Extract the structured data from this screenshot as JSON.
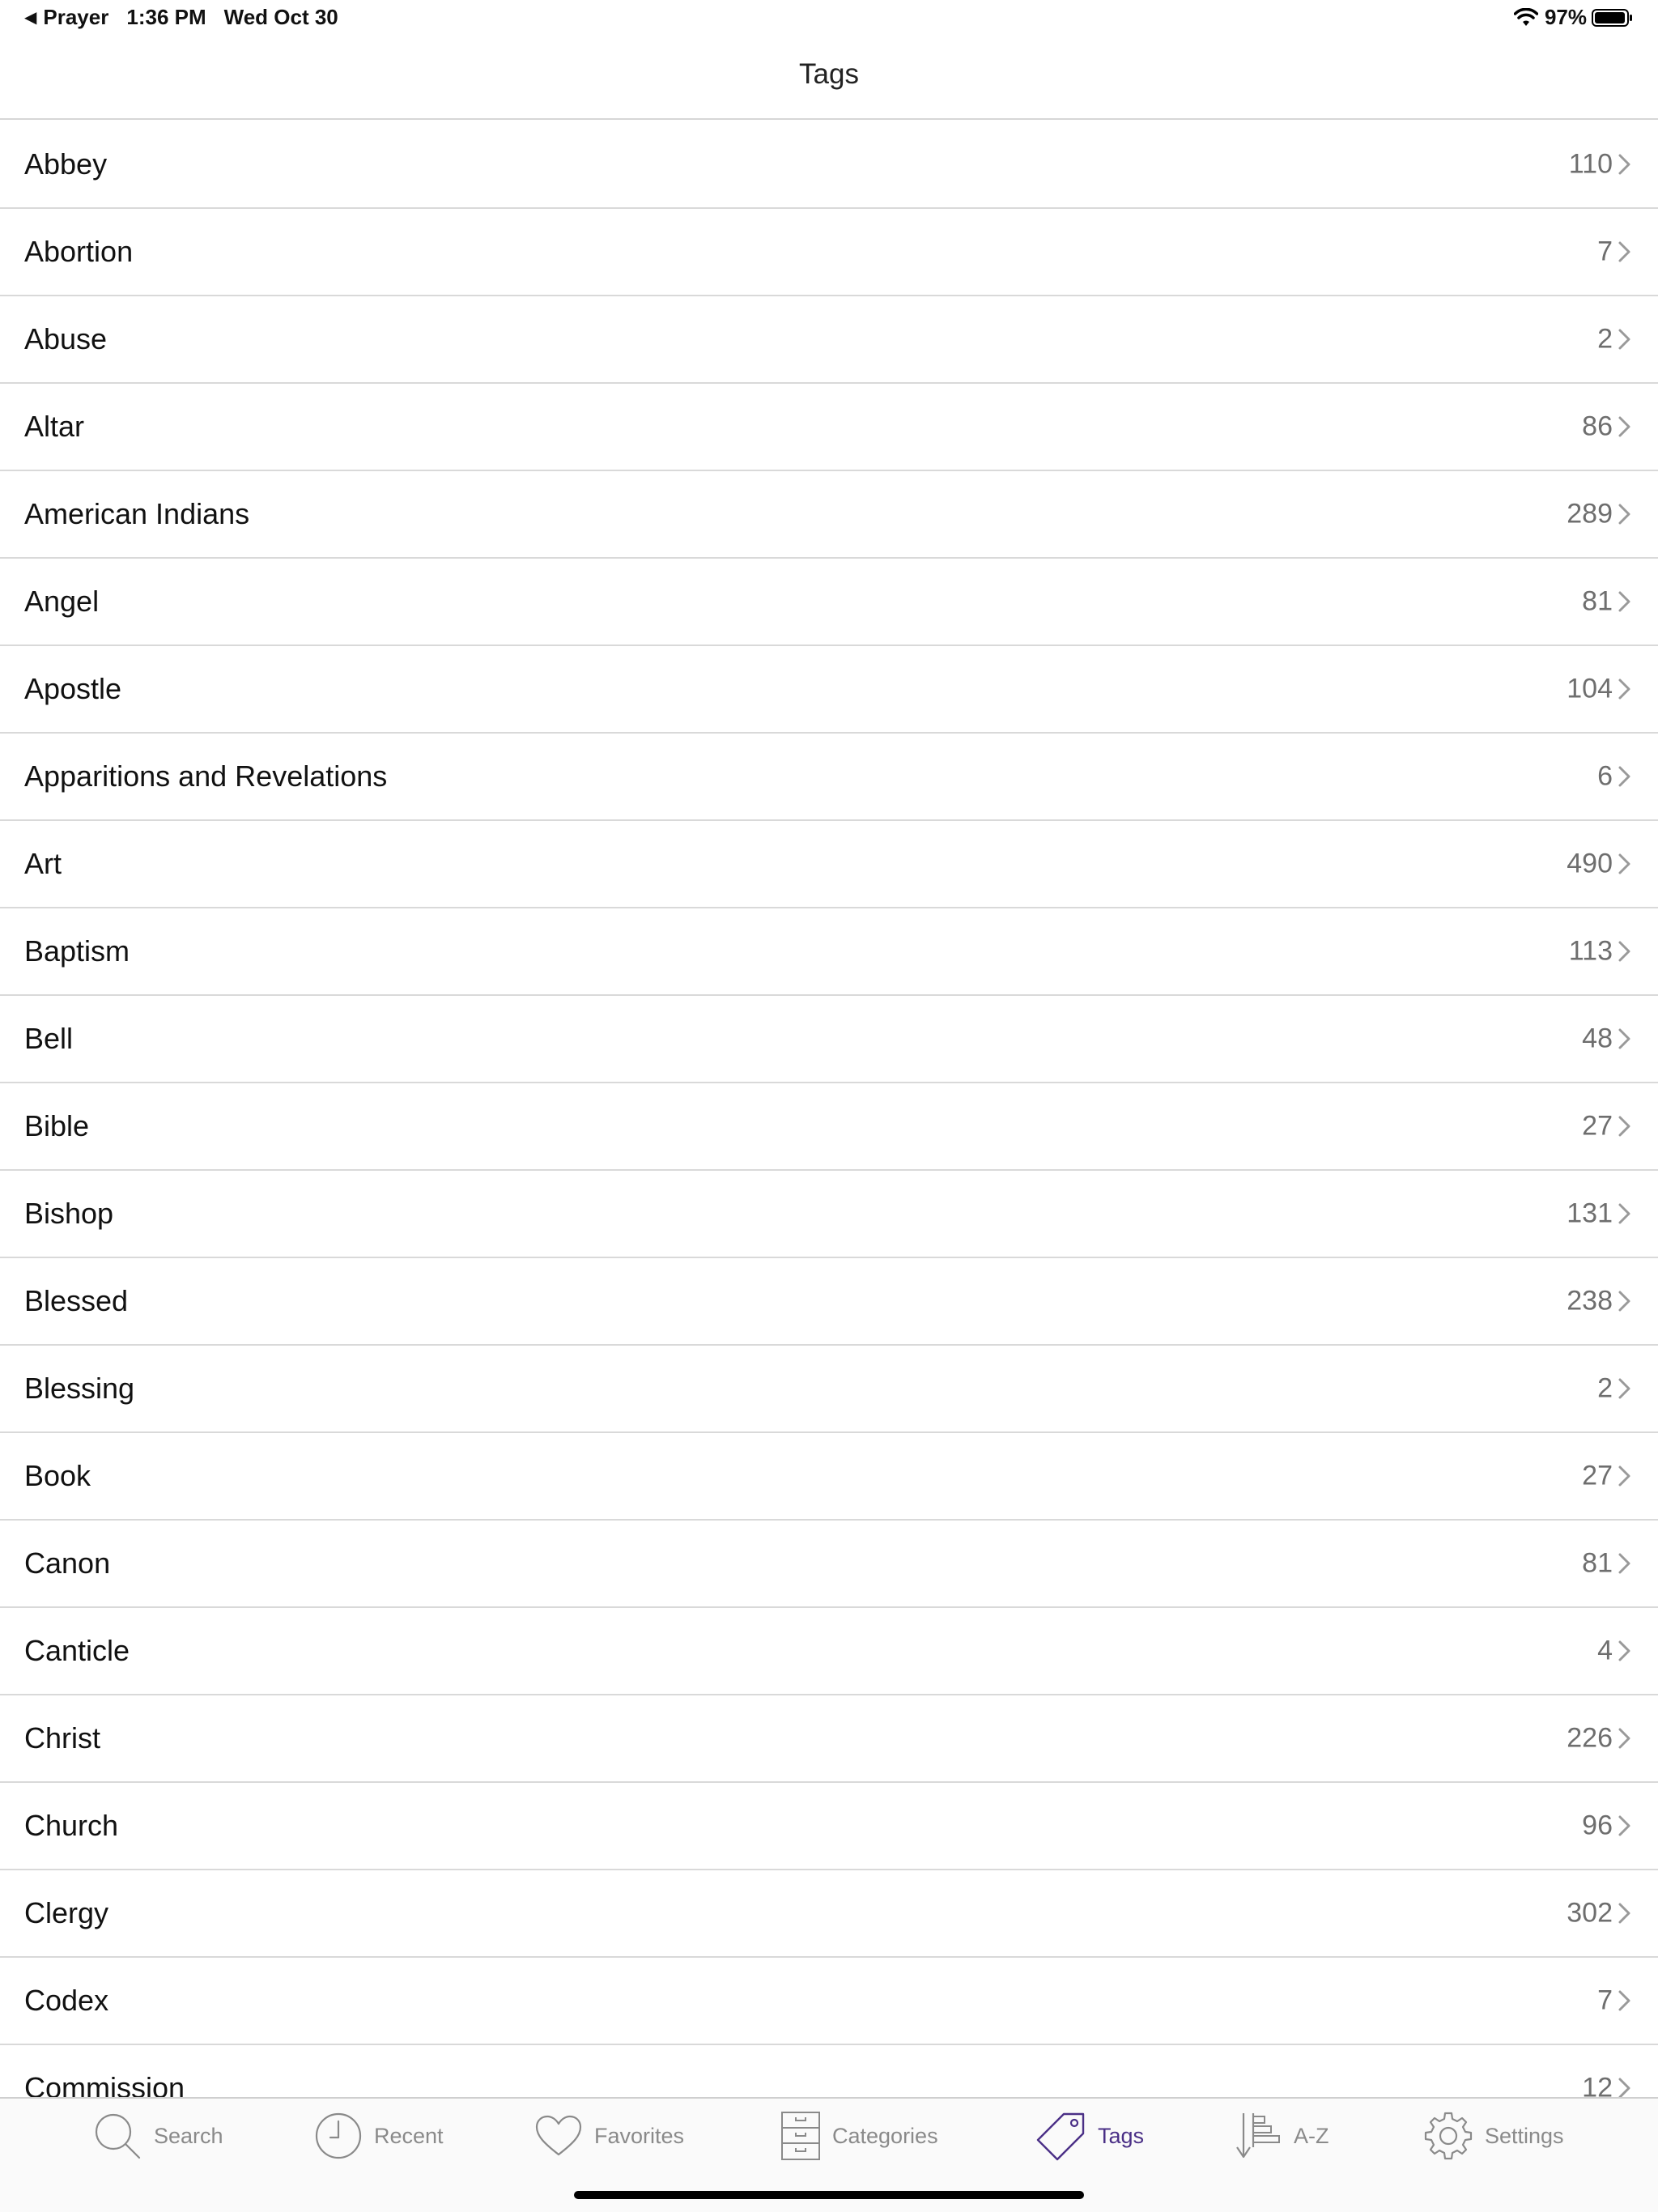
{
  "status_bar": {
    "back_app": "Prayer",
    "time": "1:36 PM",
    "date": "Wed Oct 30",
    "battery": "97%"
  },
  "nav": {
    "title": "Tags"
  },
  "tags": [
    {
      "label": "Abbey",
      "count": "110"
    },
    {
      "label": "Abortion",
      "count": "7"
    },
    {
      "label": "Abuse",
      "count": "2"
    },
    {
      "label": "Altar",
      "count": "86"
    },
    {
      "label": "American Indians",
      "count": "289"
    },
    {
      "label": "Angel",
      "count": "81"
    },
    {
      "label": "Apostle",
      "count": "104"
    },
    {
      "label": "Apparitions and Revelations",
      "count": "6"
    },
    {
      "label": "Art",
      "count": "490"
    },
    {
      "label": "Baptism",
      "count": "113"
    },
    {
      "label": "Bell",
      "count": "48"
    },
    {
      "label": "Bible",
      "count": "27"
    },
    {
      "label": "Bishop",
      "count": "131"
    },
    {
      "label": "Blessed",
      "count": "238"
    },
    {
      "label": "Blessing",
      "count": "2"
    },
    {
      "label": "Book",
      "count": "27"
    },
    {
      "label": "Canon",
      "count": "81"
    },
    {
      "label": "Canticle",
      "count": "4"
    },
    {
      "label": "Christ",
      "count": "226"
    },
    {
      "label": "Church",
      "count": "96"
    },
    {
      "label": "Clergy",
      "count": "302"
    },
    {
      "label": "Codex",
      "count": "7"
    },
    {
      "label": "Commission",
      "count": "12"
    }
  ],
  "tab_bar": {
    "active": "tags",
    "active_color": "#4a2f86",
    "inactive_color": "#8a8a8a",
    "items": [
      {
        "id": "search",
        "label": "Search",
        "icon": "search-icon"
      },
      {
        "id": "recent",
        "label": "Recent",
        "icon": "clock-icon"
      },
      {
        "id": "favorites",
        "label": "Favorites",
        "icon": "heart-icon"
      },
      {
        "id": "categories",
        "label": "Categories",
        "icon": "cabinet-icon"
      },
      {
        "id": "tags",
        "label": "Tags",
        "icon": "tag-icon"
      },
      {
        "id": "az",
        "label": "A-Z",
        "icon": "sort-icon"
      },
      {
        "id": "settings",
        "label": "Settings",
        "icon": "gear-icon"
      }
    ]
  }
}
